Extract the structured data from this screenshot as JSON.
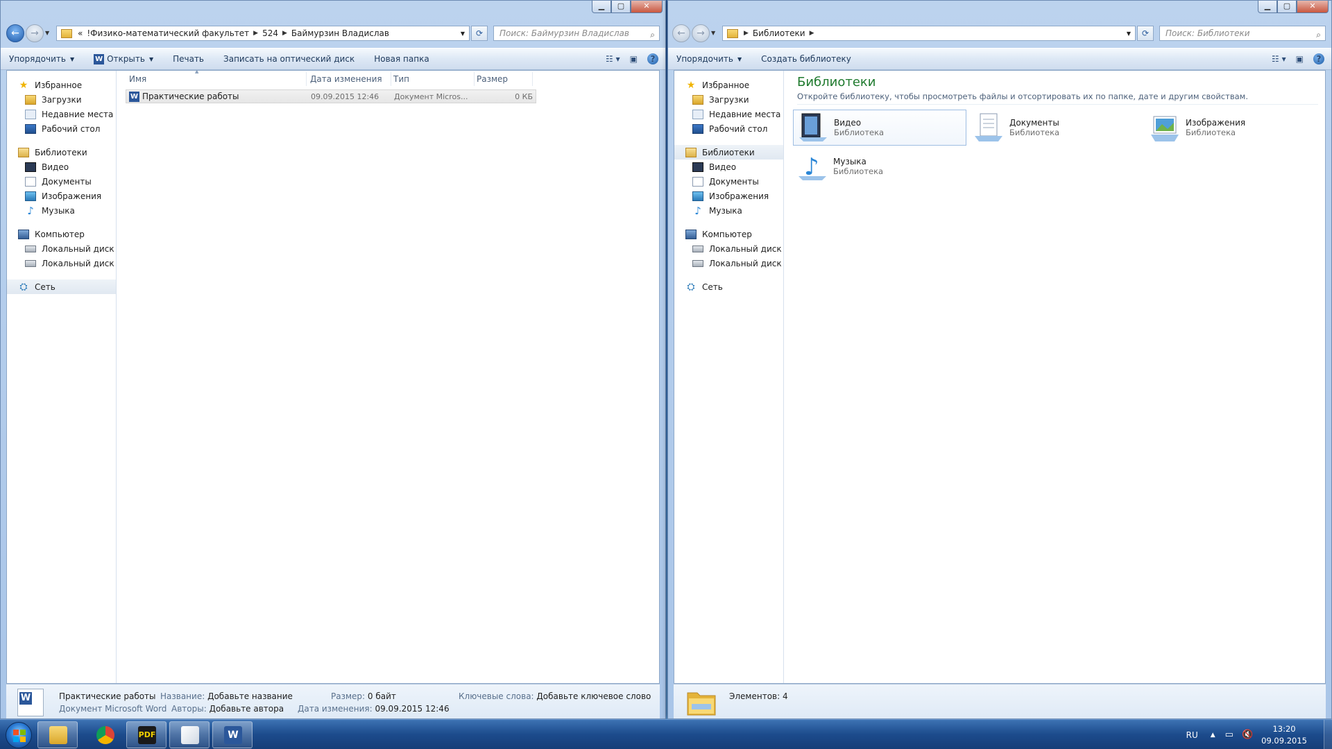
{
  "left_window": {
    "address": {
      "overflow": "«",
      "crumbs": [
        "!Физико-математический факультет",
        "524",
        "Баймурзин Владислав"
      ]
    },
    "search_placeholder": "Поиск: Баймурзин Владислав",
    "toolbar": {
      "organize": "Упорядочить",
      "open": "Открыть",
      "print": "Печать",
      "burn": "Записать на оптический диск",
      "new_folder": "Новая папка"
    },
    "columns": {
      "name": "Имя",
      "date": "Дата изменения",
      "type": "Тип",
      "size": "Размер"
    },
    "files": [
      {
        "name": "Практические  работы",
        "date": "09.09.2015 12:46",
        "type": "Документ Micros...",
        "size": "0 КБ"
      }
    ],
    "details": {
      "file_name": "Практические  работы",
      "file_kind": "Документ Microsoft Word",
      "title_label": "Название:",
      "title_value": "Добавьте название",
      "authors_label": "Авторы:",
      "authors_value": "Добавьте автора",
      "size_label": "Размер:",
      "size_value": "0 байт",
      "modified_label": "Дата изменения:",
      "modified_value": "09.09.2015 12:46",
      "keywords_label": "Ключевые слова:",
      "keywords_value": "Добавьте ключевое слово"
    }
  },
  "right_window": {
    "address": {
      "crumbs": [
        "Библиотеки"
      ]
    },
    "search_placeholder": "Поиск: Библиотеки",
    "toolbar": {
      "organize": "Упорядочить",
      "create_library": "Создать библиотеку"
    },
    "heading": "Библиотеки",
    "subheading": "Откройте библиотеку, чтобы просмотреть файлы и отсортировать их по папке, дате и другим свойствам.",
    "libraries": [
      {
        "name": "Видео",
        "kind": "Библиотека"
      },
      {
        "name": "Документы",
        "kind": "Библиотека"
      },
      {
        "name": "Изображения",
        "kind": "Библиотека"
      },
      {
        "name": "Музыка",
        "kind": "Библиотека"
      }
    ],
    "details": {
      "count": "Элементов: 4"
    }
  },
  "nav_pane": {
    "favorites": "Избранное",
    "downloads": "Загрузки",
    "recent": "Недавние места",
    "desktop": "Рабочий стол",
    "libraries": "Библиотеки",
    "video": "Видео",
    "documents": "Документы",
    "images": "Изображения",
    "music": "Музыка",
    "computer": "Компьютер",
    "disk_c": "Локальный диск (C",
    "disk_d": "Локальный диск (D",
    "network": "Сеть"
  },
  "taskbar": {
    "apps": [
      "explorer",
      "chrome",
      "pdf",
      "paint",
      "word"
    ],
    "pdf_label": "PDF",
    "word_label": "W",
    "lang": "RU",
    "time": "13:20",
    "date": "09.09.2015"
  },
  "colors": {
    "accent": "#1f7a2e",
    "taskbar": "#1c4b8c"
  }
}
